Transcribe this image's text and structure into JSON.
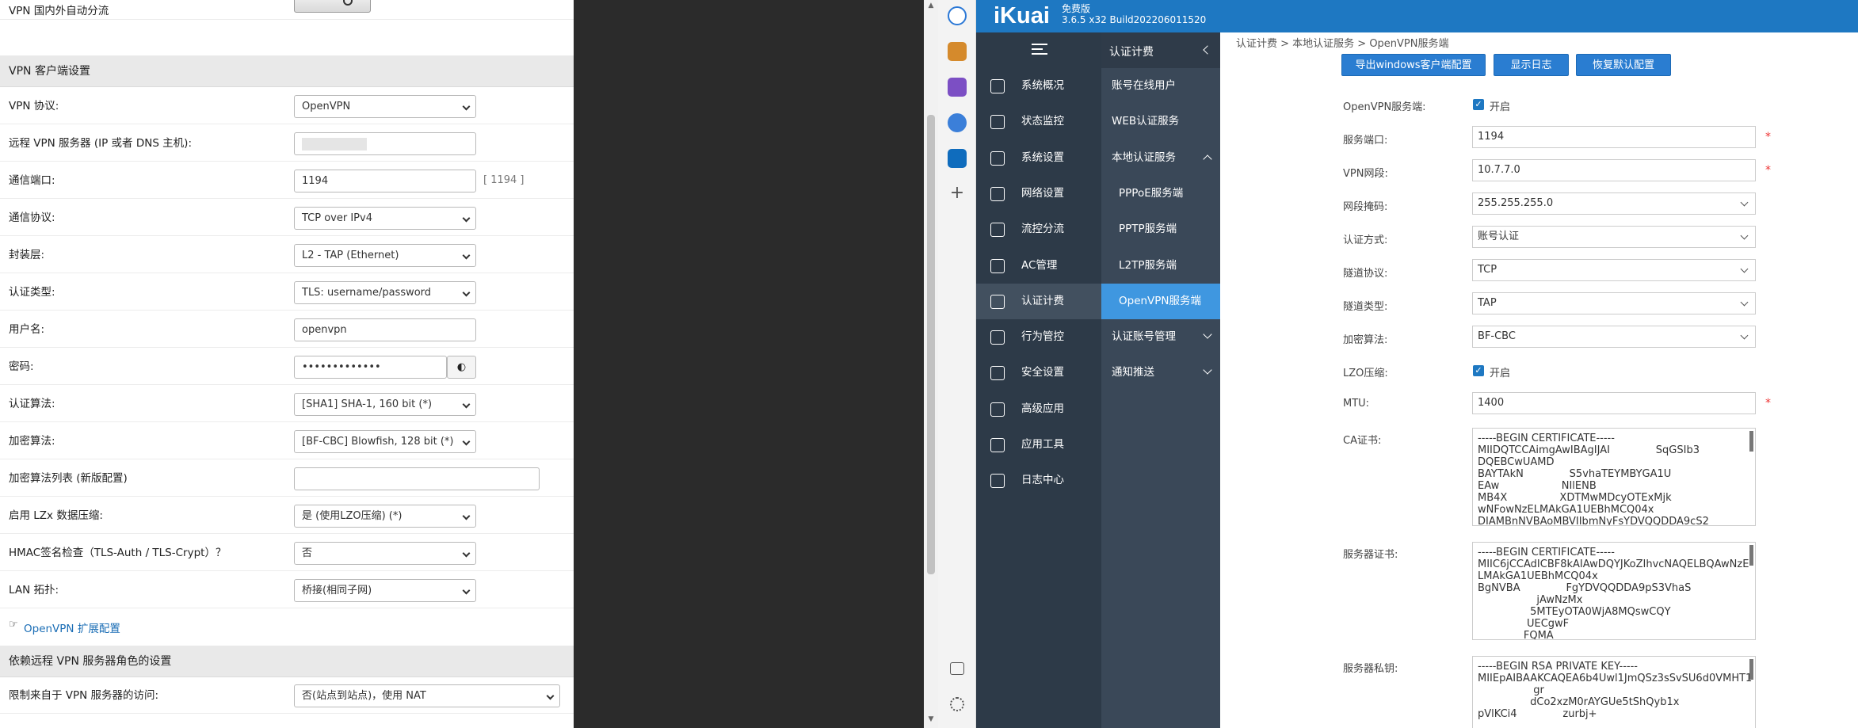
{
  "left": {
    "rows": [
      {
        "label": "VPN 国内外自动分流",
        "type": "toggle"
      },
      {
        "section": "VPN 客户端设置"
      },
      {
        "label": "VPN 协议:",
        "type": "select",
        "value": "OpenVPN"
      },
      {
        "label": "远程 VPN 服务器 (IP 或者 DNS 主机):",
        "type": "input",
        "value": ""
      },
      {
        "label": "通信端口:",
        "type": "input",
        "value": "1194",
        "hint": "[ 1194 ]"
      },
      {
        "label": "通信协议:",
        "type": "select",
        "value": "TCP over IPv4"
      },
      {
        "label": "封装层:",
        "type": "select",
        "value": "L2 - TAP (Ethernet)"
      },
      {
        "label": "认证类型:",
        "type": "select",
        "value": "TLS: username/password"
      },
      {
        "label": "用户名:",
        "type": "input",
        "value": "openvpn"
      },
      {
        "label": "密码:",
        "type": "password",
        "value": "•••••••••••••"
      },
      {
        "label": "认证算法:",
        "type": "select",
        "value": "[SHA1] SHA-1, 160 bit (*)"
      },
      {
        "label": "加密算法:",
        "type": "select",
        "value": "[BF-CBC] Blowfish, 128 bit (*)"
      },
      {
        "label": "加密算法列表 (新版配置)",
        "type": "input-wide",
        "value": ""
      },
      {
        "label": "启用 LZx 数据压缩:",
        "type": "select",
        "value": "是 (使用LZO压缩) (*)"
      },
      {
        "label": "HMAC签名检查（TLS-Auth / TLS-Crypt）？",
        "type": "select",
        "value": "否"
      },
      {
        "label": "LAN 拓扑:",
        "type": "select",
        "value": "桥接(相同子网)"
      },
      {
        "link": "OpenVPN 扩展配置"
      },
      {
        "section": "依赖远程 VPN 服务器角色的设置"
      },
      {
        "label": "限制来自于 VPN 服务器的访问:",
        "type": "select-wide",
        "value": "否(站点到站点)，使用 NAT"
      }
    ]
  },
  "ikuai": {
    "logo": "iKuai",
    "edition": "免费版",
    "version": "3.6.5 x32 Build202206011520",
    "nav": [
      "系统概况",
      "状态监控",
      "系统设置",
      "网络设置",
      "流控分流",
      "AC管理",
      "认证计费",
      "行为管控",
      "安全设置",
      "高级应用",
      "应用工具",
      "日志中心"
    ],
    "nav_active": 6,
    "sub_title": "认证计费",
    "sub": [
      {
        "label": "账号在线用户"
      },
      {
        "label": "WEB认证服务"
      },
      {
        "label": "本地认证服务",
        "chev": "up"
      },
      {
        "label": "PPPoE服务端",
        "sub": true
      },
      {
        "label": "PPTP服务端",
        "sub": true
      },
      {
        "label": "L2TP服务端",
        "sub": true
      },
      {
        "label": "OpenVPN服务端",
        "sub": true,
        "active": true
      },
      {
        "label": "认证账号管理",
        "chev": "dn"
      },
      {
        "label": "通知推送",
        "chev": "dn"
      }
    ],
    "breadcrumb": "认证计费 > 本地认证服务 > OpenVPN服务端",
    "buttons": [
      "导出windows客户端配置",
      "显示日志",
      "恢复默认配置"
    ],
    "form": {
      "server_label": "OpenVPN服务端:",
      "enable_text": "开启",
      "port_label": "服务端口:",
      "port": "1194",
      "net_label": "VPN网段:",
      "net": "10.7.7.0",
      "mask_label": "网段掩码:",
      "mask": "255.255.255.0",
      "auth_label": "认证方式:",
      "auth": "账号认证",
      "proto_label": "隧道协议:",
      "proto": "TCP",
      "type_label": "隧道类型:",
      "type": "TAP",
      "cipher_label": "加密算法:",
      "cipher": "BF-CBC",
      "lzo_label": "LZO压缩:",
      "lzo_text": "开启",
      "mtu_label": "MTU:",
      "mtu": "1400",
      "ca_label": "CA证书:",
      "ca": "-----BEGIN CERTIFICATE-----\nMIIDQTCCAimgAwIBAgIJAI              SqGSIb3\nDQEBCwUAMD              \nBAYTAkN              S5vhaTEYMBYGA1U\nEAw                   NIlENB\nMB4X                XDTMwMDcyOTExMjk\nwNFowNzELMAkGA1UEBhMCQ04x\nDIAMBnNVBAoMBVIIbmNyFsYDVQQDDA9cS2",
      "srv_cert_label": "服务器证书:",
      "srv_cert": "-----BEGIN CERTIFICATE-----\nMIIC6jCCAdICBF8kAIAwDQYJKoZIhvcNAQELBQAwNzE\nLMAkGA1UEBhMCQ04x\nBgNVBA              FgYDVQQDDA9pS3VhaS\n                  jAwNzMx\n                5MTEyOTA0WjA8MQswCQY\n               UECgwF\n              FQMA",
      "key_label": "服务器私钥:",
      "key": "-----BEGIN RSA PRIVATE KEY-----\nMIIEpAIBAAKCAQEA6b4Uwl1JmQSz3sSvSU6d0VMHT1\n                 gr\n                dCo2xzM0rAYGUe5tShQyb1x\npVlKCi4              zurbj+"
    }
  }
}
